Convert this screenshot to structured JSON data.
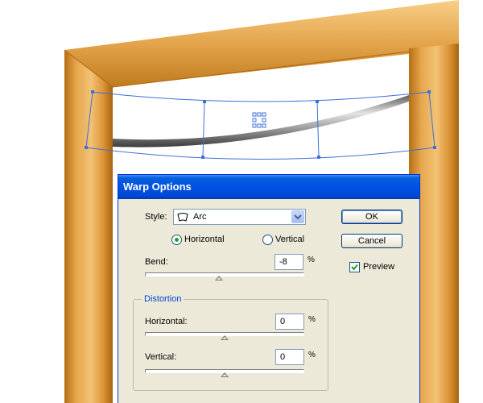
{
  "dialog": {
    "title": "Warp Options",
    "style_label": "Style:",
    "style_value": "Arc",
    "style_icon": "arc-warp-icon",
    "horizontal_label": "Horizontal",
    "vertical_label": "Vertical",
    "orientation_selected": "Horizontal",
    "bend_label": "Bend:",
    "bend_value": "-8",
    "bend_unit": "%",
    "bend_slider_value": -8,
    "distortion_title": "Distortion",
    "dist_horizontal_label": "Horizontal:",
    "dist_horizontal_value": "0",
    "dist_horizontal_unit": "%",
    "dist_vertical_label": "Vertical:",
    "dist_vertical_value": "0",
    "dist_vertical_unit": "%",
    "ok_label": "OK",
    "cancel_label": "Cancel",
    "preview_label": "Preview",
    "preview_checked": true
  },
  "colors": {
    "frame": "#e09a3a",
    "selection": "#3e6fd8",
    "titlebar": "#0054e3",
    "dialog_bg": "#ece9d8"
  }
}
